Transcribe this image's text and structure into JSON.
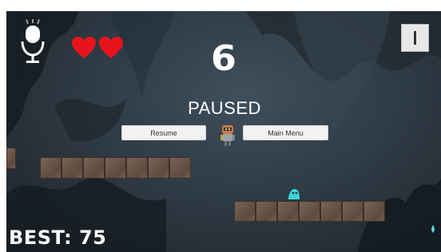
{
  "hud": {
    "score": "6",
    "best_text": "BEST: 75",
    "lives": 2,
    "mic_icon": "microphone-icon",
    "pause_icon": "pause-icon"
  },
  "pause_menu": {
    "title": "PAUSED",
    "resume_label": "Resume",
    "main_menu_label": "Main Menu"
  },
  "colors": {
    "heart": "#e8141c",
    "platform": "#6d584c",
    "background": "#2f3b45",
    "slime": "#3fd6d8"
  }
}
